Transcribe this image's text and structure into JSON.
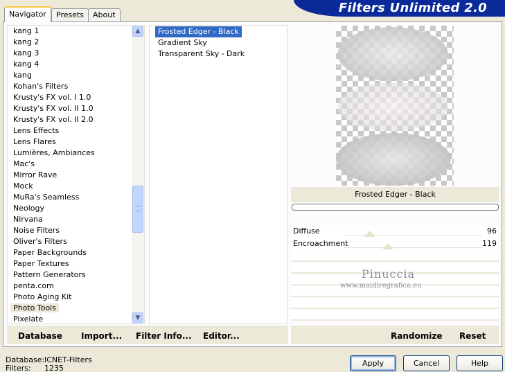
{
  "window": {
    "title": "Filters Unlimited 2.0"
  },
  "tabs": [
    {
      "label": "Navigator",
      "active": true
    },
    {
      "label": "Presets",
      "active": false
    },
    {
      "label": "About",
      "active": false
    }
  ],
  "categories": {
    "items": [
      "kang 1",
      "kang 2",
      "kang 3",
      "kang 4",
      "kang",
      "Kohan's Filters",
      "Krusty's FX vol. I 1.0",
      "Krusty's FX vol. II 1.0",
      "Krusty's FX vol. II 2.0",
      "Lens Effects",
      "Lens Flares",
      "Lumières, Ambiances",
      "Mac's",
      "Mirror Rave",
      "Mock",
      "MuRa's Seamless",
      "Neology",
      "Nirvana",
      "Noise Filters",
      "Oliver's Filters",
      "Paper Backgrounds",
      "Paper Textures",
      "Pattern Generators",
      "penta.com",
      "Photo Aging Kit",
      "Photo Tools",
      "Pixelate"
    ],
    "selected_index": 25
  },
  "filters": {
    "items": [
      "Frosted Edger - Black",
      "Gradient Sky",
      "Transparent Sky - Dark"
    ],
    "selected_index": 0
  },
  "preview": {
    "filter_name": "Frosted Edger - Black"
  },
  "parameters": [
    {
      "label": "Diffuse",
      "value": "96"
    },
    {
      "label": "Encroachment",
      "value": "119"
    }
  ],
  "watermark": {
    "name": "Pinuccia",
    "url": "www.maidiregrafica.eu"
  },
  "toolbar": {
    "database": "Database",
    "import": "Import...",
    "filter_info": "Filter Info...",
    "editor": "Editor...",
    "randomize": "Randomize",
    "reset": "Reset"
  },
  "status": {
    "database_label": "Database:",
    "database_value": "ICNET-Filters",
    "filters_label": "Filters:",
    "filters_value": "1235"
  },
  "buttons": {
    "apply": "Apply",
    "cancel": "Cancel",
    "help": "Help"
  },
  "colors": {
    "banner": "#0a2a9a",
    "selection": "#316ac5",
    "panel_bg": "#ece9d8"
  }
}
